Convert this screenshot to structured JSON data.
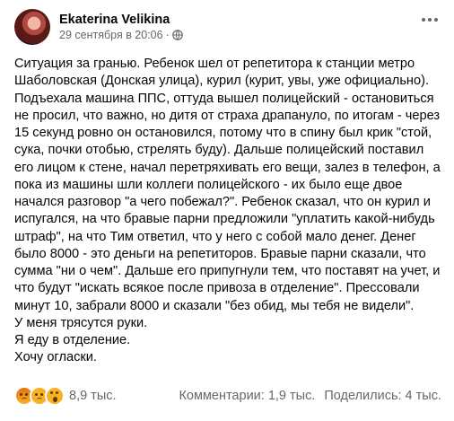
{
  "post": {
    "author": "Ekaterina Velikina",
    "timestamp": "29 сентября в 20:06",
    "separator": "·",
    "privacy_icon": "globe-icon",
    "menu_icon": "more-options-icon",
    "paragraph": "Ситуация за гранью. Ребенок шел от репетитора к станции метро Шаболовская (Донская улица), курил (курит, увы, уже официально). Подъехала машина ППС, оттуда вышел полицейский - остановиться не просил, что важно, но дитя от страха драпануло, по итогам - через 15 секунд ровно он остановился, потому что в спину был крик \"стой, сука, почки отобью, стрелять буду). Дальше полицейский поставил его лицом к стене, начал перетряхивать его вещи, залез в телефон, а пока из машины шли коллеги полицейского - их было еще двое начался разговор \"а чего побежал?\". Ребенок сказал, что он курил и испугался, на что бравые парни предложили \"уплатить какой-нибудь штраф\", на что Тим ответил, что у него с собой мало денег. Денег было 8000 - это деньги на репетиторов. Бравые парни сказали, что сумма \"ни о чем\". Дальше его припугнули тем, что поставят на учет, и что будут \"искать всякое после привоза в отделение\". Прессовали минут 10, забрали 8000 и сказали \"без обид, мы тебя не видели\".",
    "line2": "У меня трясутся руки.",
    "line3": "Я еду в отделение.",
    "line4": "Хочу огласки."
  },
  "footer": {
    "reaction_icons": [
      "angry-icon",
      "sad-icon",
      "wow-icon"
    ],
    "reaction_count": "8,9 тыс.",
    "comments": "Комментарии: 1,9 тыс.",
    "shares": "Поделились: 4 тыс."
  }
}
